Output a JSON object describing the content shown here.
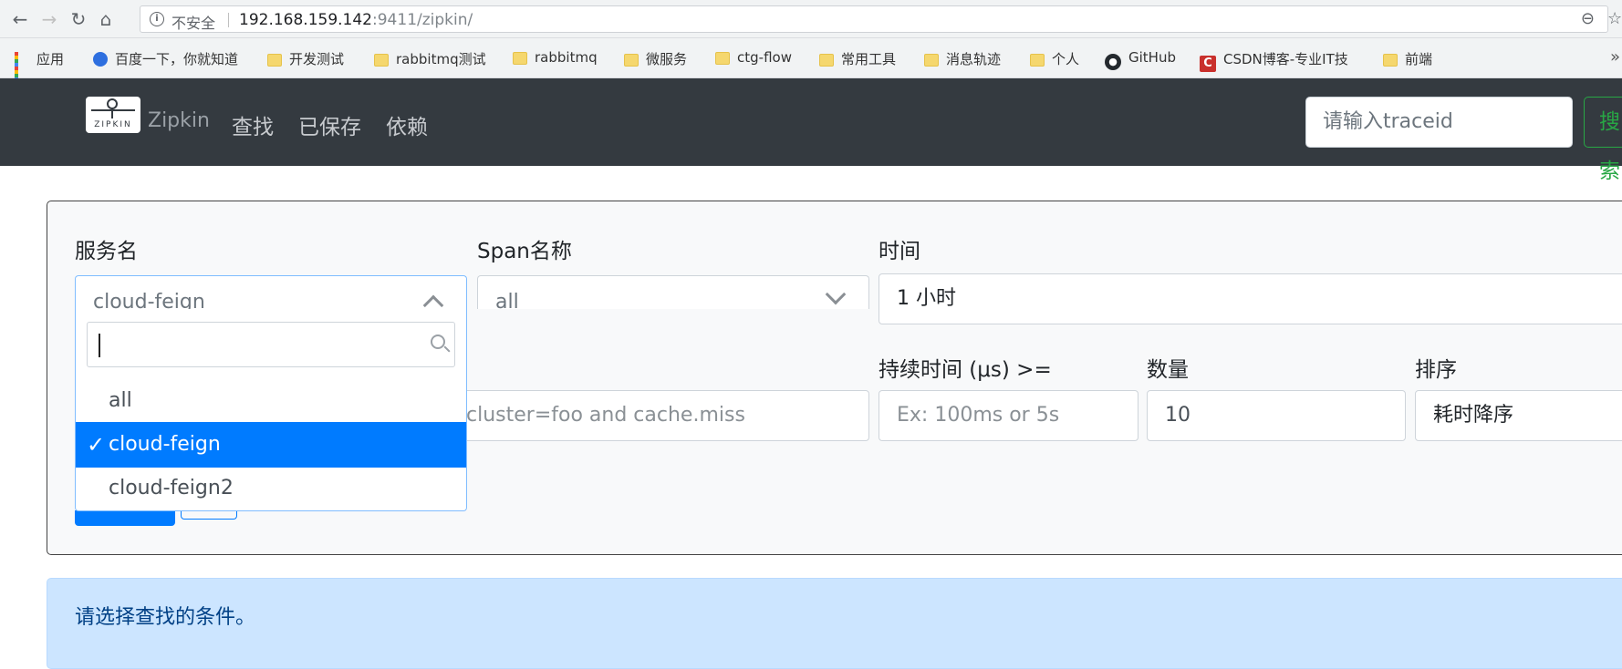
{
  "browser": {
    "insecure_label": "不安全",
    "url_host": "192.168.159.142",
    "url_rest": ":9411/zipkin/",
    "bookmarks": [
      {
        "label": "应用",
        "icon": "apps-grid-icon"
      },
      {
        "label": "百度一下，你就知道",
        "icon": "baidu-icon"
      },
      {
        "label": "开发测试",
        "icon": "folder-icon"
      },
      {
        "label": "rabbitmq测试",
        "icon": "folder-icon"
      },
      {
        "label": "rabbitmq",
        "icon": "folder-icon"
      },
      {
        "label": "微服务",
        "icon": "folder-icon"
      },
      {
        "label": "ctg-flow",
        "icon": "folder-icon"
      },
      {
        "label": "常用工具",
        "icon": "folder-icon"
      },
      {
        "label": "消息轨迹",
        "icon": "folder-icon"
      },
      {
        "label": "个人",
        "icon": "folder-icon"
      },
      {
        "label": "GitHub",
        "icon": "github-icon"
      },
      {
        "label": "CSDN博客-专业IT技",
        "icon": "csdn-icon"
      },
      {
        "label": "前端",
        "icon": "folder-icon"
      }
    ]
  },
  "navbar": {
    "logo_text": "ZIPKIN",
    "brand": "Zipkin",
    "links": [
      "查找",
      "已保存",
      "依赖"
    ],
    "traceid_placeholder": "请输入traceid",
    "search_label": "搜索"
  },
  "form": {
    "service_label": "服务名",
    "service_value": "cloud-feign",
    "span_label": "Span名称",
    "span_value": "all",
    "time_label": "时间",
    "time_value": "1 小时",
    "annotation_placeholder": "cluster=foo and cache.miss",
    "duration_label": "持续时间 (μs) >=",
    "duration_placeholder": "Ex: 100ms or 5s",
    "count_label": "数量",
    "count_value": "10",
    "sort_label": "排序",
    "sort_value": "耗时降序"
  },
  "dropdown": {
    "options": [
      "all",
      "cloud-feign",
      "cloud-feign2"
    ],
    "selected": "cloud-feign"
  },
  "alert": {
    "message": "请选择查找的条件。"
  },
  "colors": {
    "navbar_bg": "#343a40",
    "primary": "#007bff",
    "success": "#28a745",
    "alert_bg": "#cce5ff"
  }
}
